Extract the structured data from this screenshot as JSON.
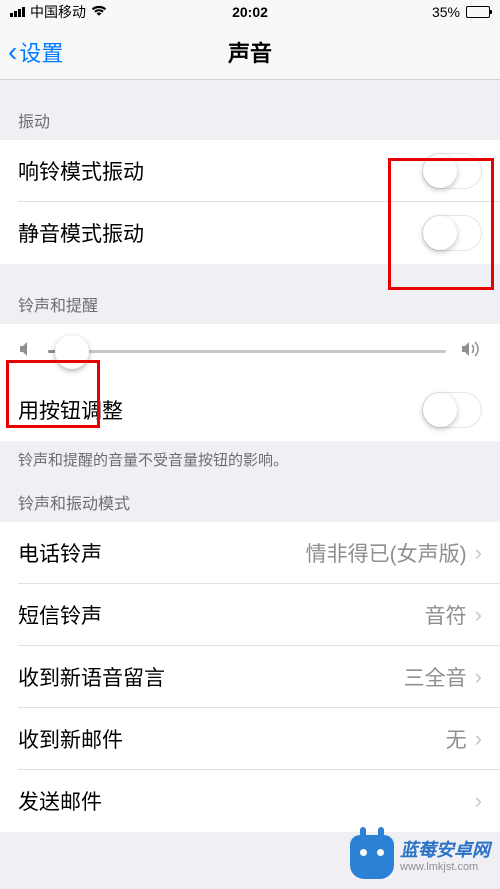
{
  "status_bar": {
    "carrier": "中国移动",
    "time": "20:02",
    "battery_percent": "35%"
  },
  "nav": {
    "back_label": "设置",
    "title": "声音"
  },
  "sections": {
    "vibration": {
      "header": "振动",
      "ring_vibration": "响铃模式振动",
      "silent_vibration": "静音模式振动"
    },
    "ringer_alerts": {
      "header": "铃声和提醒",
      "change_with_buttons": "用按钮调整",
      "footer": "铃声和提醒的音量不受音量按钮的影响。"
    },
    "sounds_patterns": {
      "header": "铃声和振动模式",
      "ringtone": {
        "label": "电话铃声",
        "value": "情非得已(女声版)"
      },
      "text_tone": {
        "label": "短信铃声",
        "value": "音符"
      },
      "new_voicemail": {
        "label": "收到新语音留言",
        "value": "三全音"
      },
      "new_mail": {
        "label": "收到新邮件",
        "value": "无"
      },
      "sent_mail": {
        "label": "发送邮件",
        "value": ""
      }
    }
  },
  "watermark": {
    "title": "蓝莓安卓网",
    "url": "www.lmkjst.com"
  }
}
